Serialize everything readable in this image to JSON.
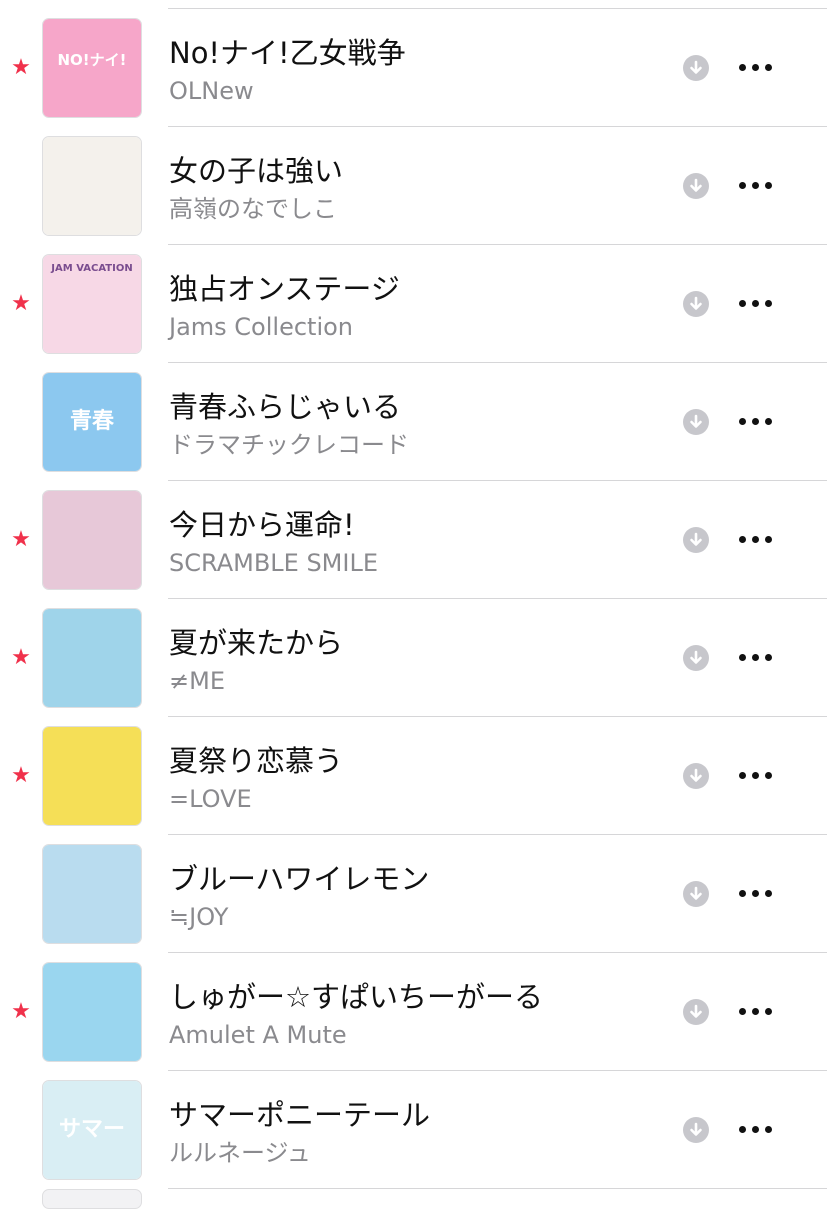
{
  "songs": [
    {
      "title": "No!ナイ!乙女戦争",
      "artist": "OLNew",
      "favorite": true,
      "art_text": "NO!ナイ!",
      "art_bg": "#f6a6c9",
      "art_fg": "#ffffff"
    },
    {
      "title": "女の子は強い",
      "artist": "高嶺のなでしこ",
      "favorite": false,
      "art_text": "",
      "art_bg": "#f4f1ec",
      "art_fg": "#6b5a48"
    },
    {
      "title": "独占オンステージ",
      "artist": "Jams Collection",
      "favorite": true,
      "art_text": "JAM VACATION",
      "art_bg": "#f7d8e6",
      "art_fg": "#7a4d8f"
    },
    {
      "title": "青春ふらじゃいる",
      "artist": "ドラマチックレコード",
      "favorite": false,
      "art_text": "青春",
      "art_bg": "#8cc8ef",
      "art_fg": "#ffffff"
    },
    {
      "title": "今日から運命!",
      "artist": "SCRAMBLE SMILE",
      "favorite": true,
      "art_text": "",
      "art_bg": "#e7c8d8",
      "art_fg": "#6a2f5a"
    },
    {
      "title": "夏が来たから",
      "artist": "≠ME",
      "favorite": true,
      "art_text": "",
      "art_bg": "#9fd4ea",
      "art_fg": "#ffffff"
    },
    {
      "title": "夏祭り恋慕う",
      "artist": "=LOVE",
      "favorite": true,
      "art_text": "",
      "art_bg": "#f5df57",
      "art_fg": "#8a6a00"
    },
    {
      "title": "ブルーハワイレモン",
      "artist": "≒JOY",
      "favorite": false,
      "art_text": "",
      "art_bg": "#b9dcef",
      "art_fg": "#4a4a4a"
    },
    {
      "title": "しゅがー☆すぱいちーがーる",
      "artist": "Amulet A Mute",
      "favorite": true,
      "art_text": "",
      "art_bg": "#9ad6ef",
      "art_fg": "#ff5a9a"
    },
    {
      "title": "サマーポニーテール",
      "artist": "ルルネージュ",
      "favorite": false,
      "art_text": "サマー",
      "art_bg": "#d9eef4",
      "art_fg": "#ffffff"
    }
  ],
  "icons": {
    "favorite": "star-icon",
    "download": "download-icon",
    "more": "more-icon"
  },
  "colors": {
    "accent_red": "#f0314b",
    "secondary_text": "#8a8a8e",
    "download_gray": "#c7c7cc"
  }
}
